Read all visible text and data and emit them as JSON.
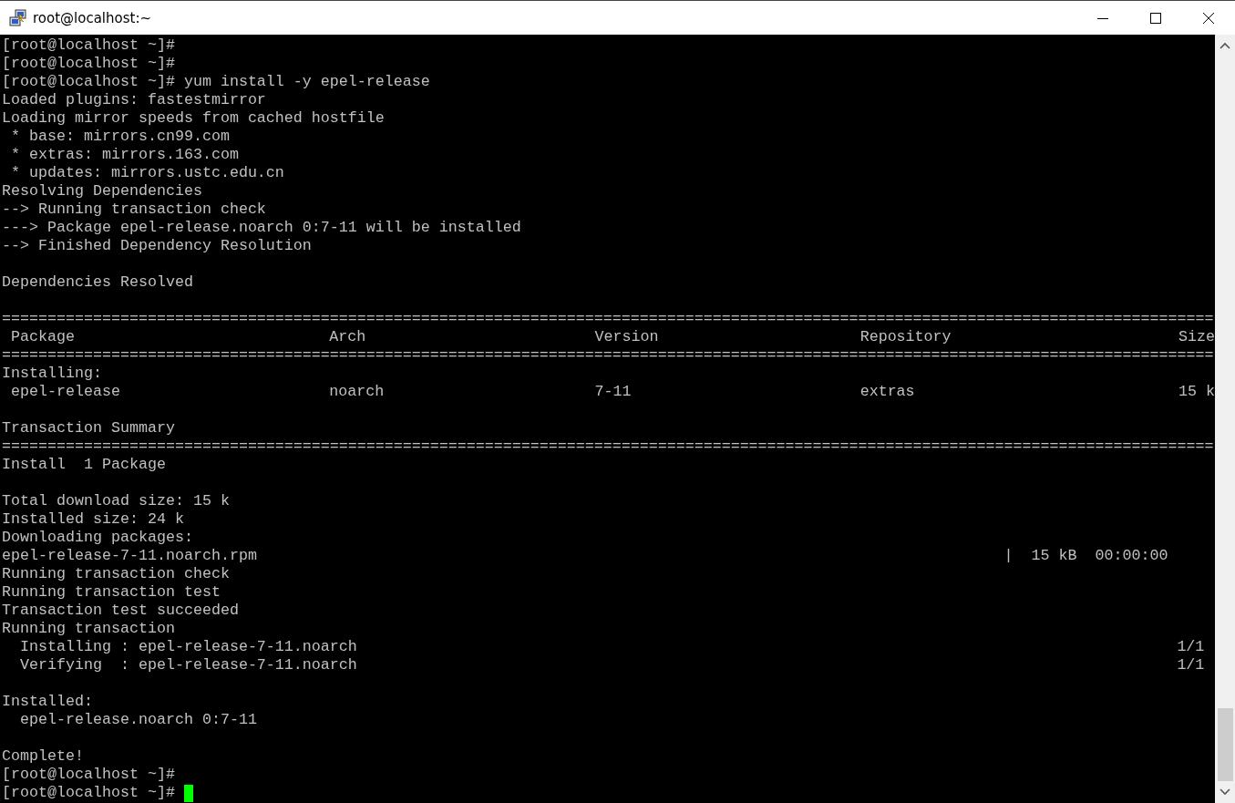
{
  "window": {
    "title": "root@localhost:~"
  },
  "terminal": {
    "lines": [
      {
        "kind": "text",
        "text": "[root@localhost ~]#"
      },
      {
        "kind": "text",
        "text": "[root@localhost ~]#"
      },
      {
        "kind": "text",
        "text": "[root@localhost ~]# yum install -y epel-release"
      },
      {
        "kind": "text",
        "text": "Loaded plugins: fastestmirror"
      },
      {
        "kind": "text",
        "text": "Loading mirror speeds from cached hostfile"
      },
      {
        "kind": "text",
        "text": " * base: mirrors.cn99.com"
      },
      {
        "kind": "text",
        "text": " * extras: mirrors.163.com"
      },
      {
        "kind": "text",
        "text": " * updates: mirrors.ustc.edu.cn"
      },
      {
        "kind": "text",
        "text": "Resolving Dependencies"
      },
      {
        "kind": "text",
        "text": "--> Running transaction check"
      },
      {
        "kind": "text",
        "text": "---> Package epel-release.noarch 0:7-11 will be installed"
      },
      {
        "kind": "text",
        "text": "--> Finished Dependency Resolution"
      },
      {
        "kind": "blank"
      },
      {
        "kind": "text",
        "text": "Dependencies Resolved"
      },
      {
        "kind": "blank"
      },
      {
        "kind": "rule",
        "text": "====================================================================================================================================="
      },
      {
        "kind": "table",
        "cells": [
          "Package",
          "Arch",
          "Version",
          "Repository",
          "Size"
        ]
      },
      {
        "kind": "rule",
        "text": "====================================================================================================================================="
      },
      {
        "kind": "text",
        "text": "Installing:"
      },
      {
        "kind": "table",
        "cells": [
          "epel-release",
          "noarch",
          "7-11",
          "extras",
          "15 k"
        ]
      },
      {
        "kind": "blank"
      },
      {
        "kind": "text",
        "text": "Transaction Summary"
      },
      {
        "kind": "rule",
        "text": "====================================================================================================================================="
      },
      {
        "kind": "text",
        "text": "Install  1 Package"
      },
      {
        "kind": "blank"
      },
      {
        "kind": "text",
        "text": "Total download size: 15 k"
      },
      {
        "kind": "text",
        "text": "Installed size: 24 k"
      },
      {
        "kind": "text",
        "text": "Downloading packages:"
      },
      {
        "kind": "progress",
        "left": "epel-release-7-11.noarch.rpm",
        "right": "|  15 kB  00:00:00"
      },
      {
        "kind": "text",
        "text": "Running transaction check"
      },
      {
        "kind": "text",
        "text": "Running transaction test"
      },
      {
        "kind": "text",
        "text": "Transaction test succeeded"
      },
      {
        "kind": "text",
        "text": "Running transaction"
      },
      {
        "kind": "step",
        "left": "  Installing : epel-release-7-11.noarch",
        "right": "1/1"
      },
      {
        "kind": "step",
        "left": "  Verifying  : epel-release-7-11.noarch",
        "right": "1/1"
      },
      {
        "kind": "blank"
      },
      {
        "kind": "text",
        "text": "Installed:"
      },
      {
        "kind": "text",
        "text": "  epel-release.noarch 0:7-11"
      },
      {
        "kind": "blank"
      },
      {
        "kind": "text",
        "text": "Complete!"
      },
      {
        "kind": "prompt",
        "text": "[root@localhost ~]#",
        "cursor": false
      },
      {
        "kind": "prompt",
        "text": "[root@localhost ~]#",
        "cursor": true
      }
    ]
  }
}
